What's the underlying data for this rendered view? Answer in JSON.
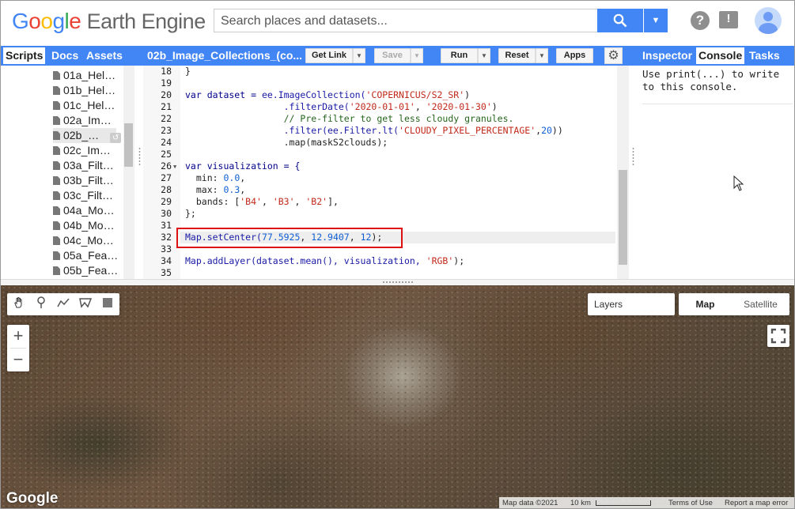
{
  "header": {
    "logo_google": "Google",
    "logo_product": "Earth Engine",
    "search_placeholder": "Search places and datasets...",
    "help_icon": "?",
    "feedback_icon": "!"
  },
  "left_tabs": [
    "Scripts",
    "Docs",
    "Assets"
  ],
  "left_active_tab": "Scripts",
  "scripts": [
    "01a_Hel…",
    "01b_Hel…",
    "01c_Hel…",
    "02a_Im…",
    "02b_…",
    "02c_Im…",
    "03a_Filt…",
    "03b_Filt…",
    "03c_Filt…",
    "04a_Mo…",
    "04b_Mo…",
    "04c_Mo…",
    "05a_Fea…",
    "05b_Fea…"
  ],
  "selected_script": "02b_…",
  "editor": {
    "script_title": "02b_Image_Collections_(co...",
    "buttons": {
      "get_link": "Get Link",
      "save": "Save",
      "run": "Run",
      "reset": "Reset",
      "apps": "Apps"
    },
    "line_numbers": [
      "18",
      "19",
      "20",
      "21",
      "22",
      "23",
      "24",
      "25",
      "26",
      "27",
      "28",
      "29",
      "30",
      "31",
      "32",
      "33",
      "34",
      "35"
    ]
  },
  "code": {
    "l18": "}",
    "l20_a": "var dataset = ",
    "l20_b": "ee.ImageCollection(",
    "l20_c": "'COPERNICUS/S2_SR'",
    "l20_d": ")",
    "l21_a": "                  .filterDate(",
    "l21_b": "'2020-01-01'",
    "l21_c": ", ",
    "l21_d": "'2020-01-30'",
    "l21_e": ")",
    "l22": "                  // Pre-filter to get less cloudy granules.",
    "l23_a": "                  .filter(ee.Filter.lt(",
    "l23_b": "'CLOUDY_PIXEL_PERCENTAGE'",
    "l23_c": ",",
    "l23_d": "20",
    "l23_e": "))",
    "l24": "                  .map(maskS2clouds);",
    "l26": "var visualization = {",
    "l27_a": "  min: ",
    "l27_b": "0.0",
    "l27_c": ",",
    "l28_a": "  max: ",
    "l28_b": "0.3",
    "l28_c": ",",
    "l29_a": "  bands: [",
    "l29_b": "'B4'",
    "l29_c": ", ",
    "l29_d": "'B3'",
    "l29_e": ", ",
    "l29_f": "'B2'",
    "l29_g": "],",
    "l30": "};",
    "l32_a": "Map.setCenter(",
    "l32_b": "77.5925",
    "l32_c": ", ",
    "l32_d": "12.9407",
    "l32_e": ", ",
    "l32_f": "12",
    "l32_g": ");",
    "l34_a": "Map.addLayer(dataset.mean(), visualization, ",
    "l34_b": "'RGB'",
    "l34_c": ");"
  },
  "right_tabs": [
    "Inspector",
    "Console",
    "Tasks"
  ],
  "right_active_tab": "Console",
  "console_text": "Use print(...) to write to this console.",
  "map": {
    "layers_label": "Layers",
    "map_type_map": "Map",
    "map_type_satellite": "Satellite",
    "zoom_in": "+",
    "zoom_out": "−",
    "google_logo": "Google",
    "attribution": {
      "data": "Map data ©2021",
      "scale": "10 km",
      "terms": "Terms of Use",
      "report": "Report a map error"
    }
  },
  "colors": {
    "accent": "#4285f4",
    "highlight_box": "#dd1111"
  }
}
